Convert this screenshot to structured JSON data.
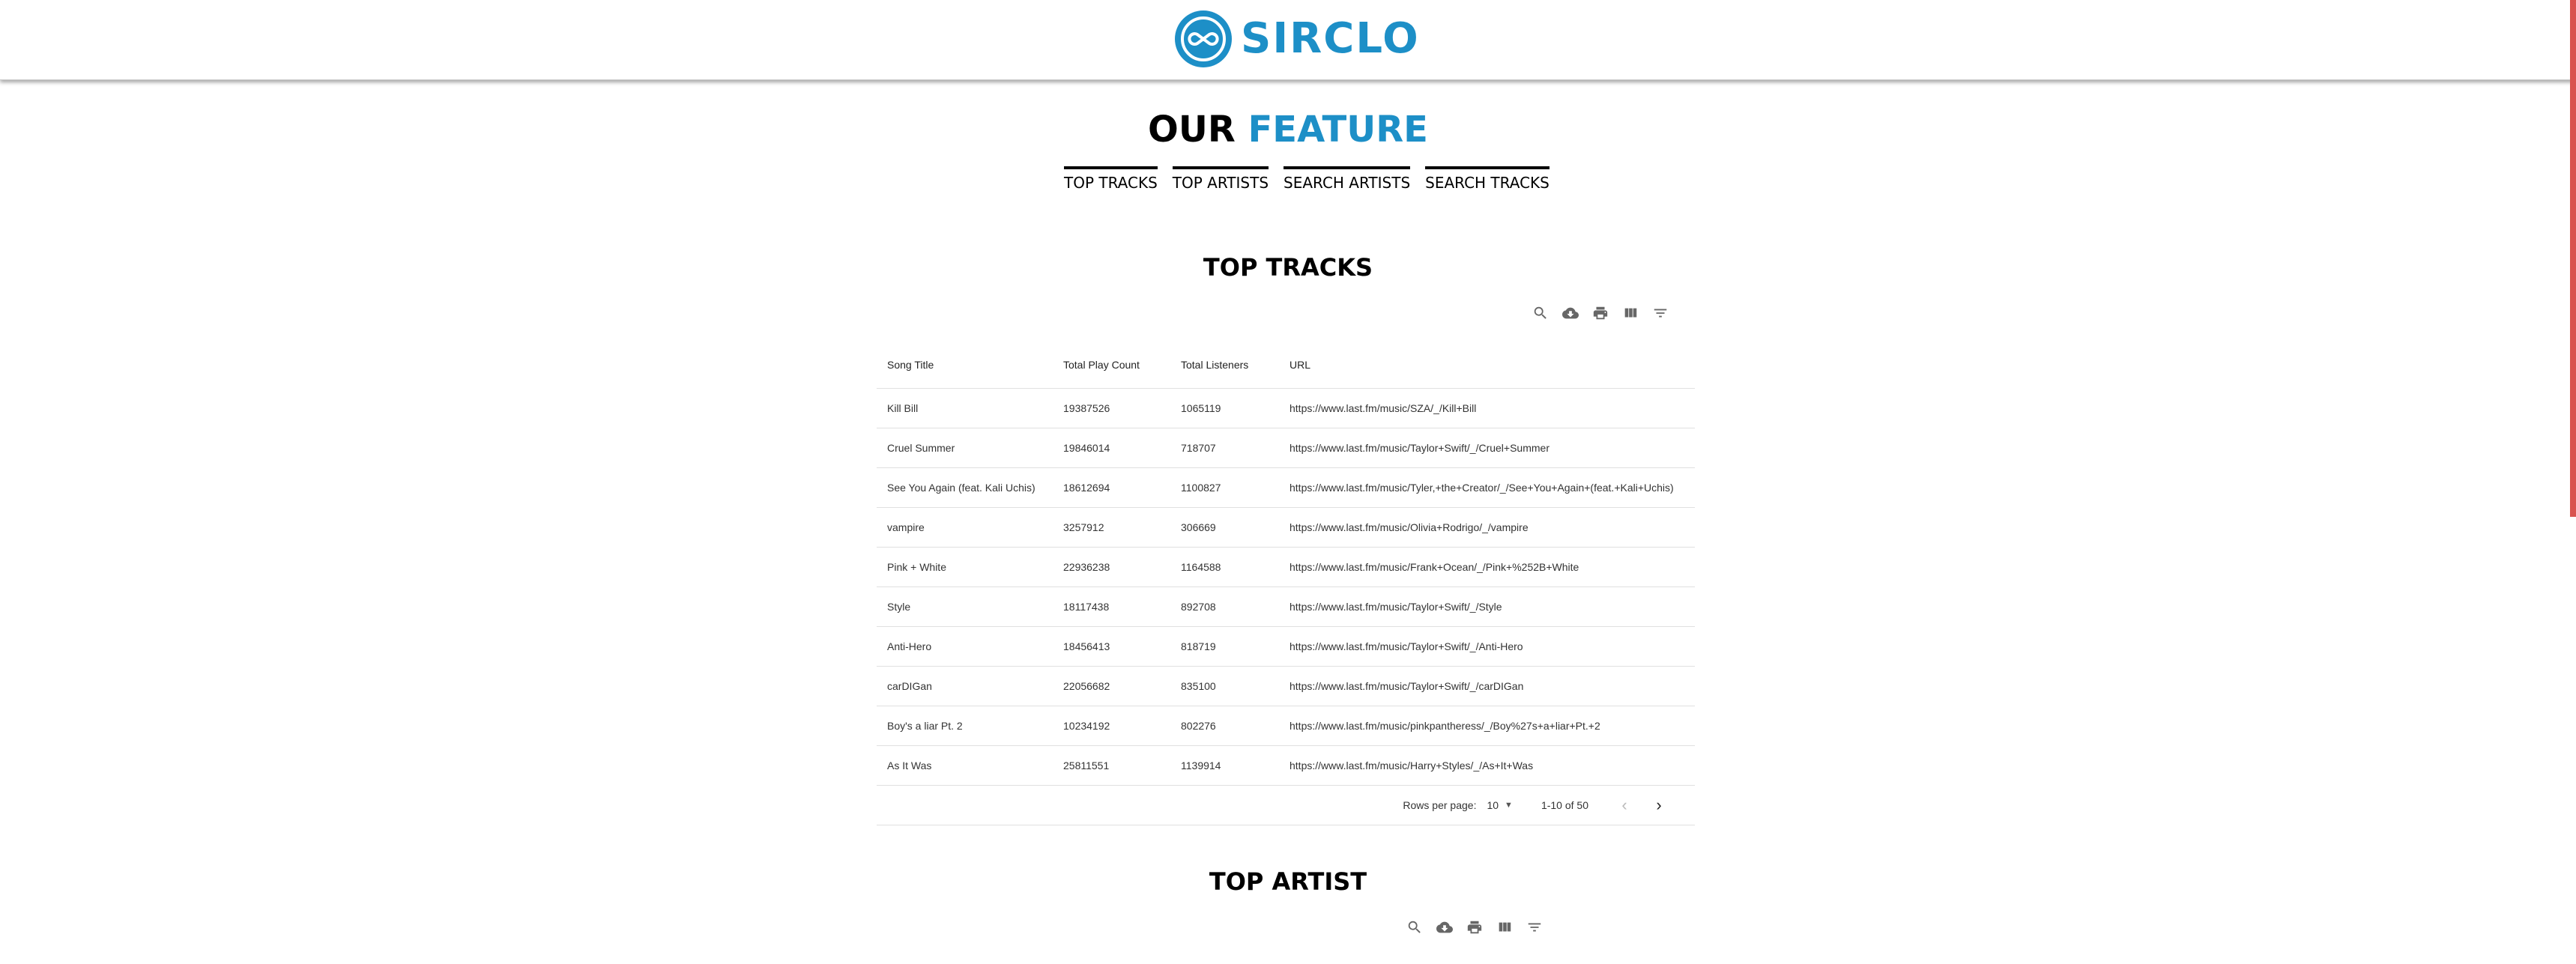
{
  "brand": {
    "name": "SIRCLO",
    "color": "#1d8fc7"
  },
  "feature": {
    "title_part1": "OUR",
    "title_part2": "FEATURE",
    "nav": [
      "TOP TRACKS",
      "TOP ARTISTS",
      "SEARCH ARTISTS",
      "SEARCH TRACKS"
    ]
  },
  "top_tracks": {
    "title": "TOP TRACKS",
    "toolbar_icons": [
      "search-icon",
      "cloud-download-icon",
      "print-icon",
      "view-column-icon",
      "filter-icon"
    ],
    "columns": [
      "Song Title",
      "Total Play Count",
      "Total Listeners",
      "URL"
    ],
    "rows": [
      [
        "Kill Bill",
        "19387526",
        "1065119",
        "https://www.last.fm/music/SZA/_/Kill+Bill"
      ],
      [
        "Cruel Summer",
        "19846014",
        "718707",
        "https://www.last.fm/music/Taylor+Swift/_/Cruel+Summer"
      ],
      [
        "See You Again (feat. Kali Uchis)",
        "18612694",
        "1100827",
        "https://www.last.fm/music/Tyler,+the+Creator/_/See+You+Again+(feat.+Kali+Uchis)"
      ],
      [
        "vampire",
        "3257912",
        "306669",
        "https://www.last.fm/music/Olivia+Rodrigo/_/vampire"
      ],
      [
        "Pink + White",
        "22936238",
        "1164588",
        "https://www.last.fm/music/Frank+Ocean/_/Pink+%252B+White"
      ],
      [
        "Style",
        "18117438",
        "892708",
        "https://www.last.fm/music/Taylor+Swift/_/Style"
      ],
      [
        "Anti-Hero",
        "18456413",
        "818719",
        "https://www.last.fm/music/Taylor+Swift/_/Anti-Hero"
      ],
      [
        "carDIGan",
        "22056682",
        "835100",
        "https://www.last.fm/music/Taylor+Swift/_/carDIGan"
      ],
      [
        "Boy's a liar Pt. 2",
        "10234192",
        "802276",
        "https://www.last.fm/music/pinkpantheress/_/Boy%27s+a+liar+Pt.+2"
      ],
      [
        "As It Was",
        "25811551",
        "1139914",
        "https://www.last.fm/music/Harry+Styles/_/As+It+Was"
      ]
    ],
    "pagination": {
      "rows_per_page_label": "Rows per page:",
      "rows_per_page_value": "10",
      "range": "1-10 of 50"
    }
  },
  "top_artist": {
    "title": "TOP ARTIST"
  }
}
